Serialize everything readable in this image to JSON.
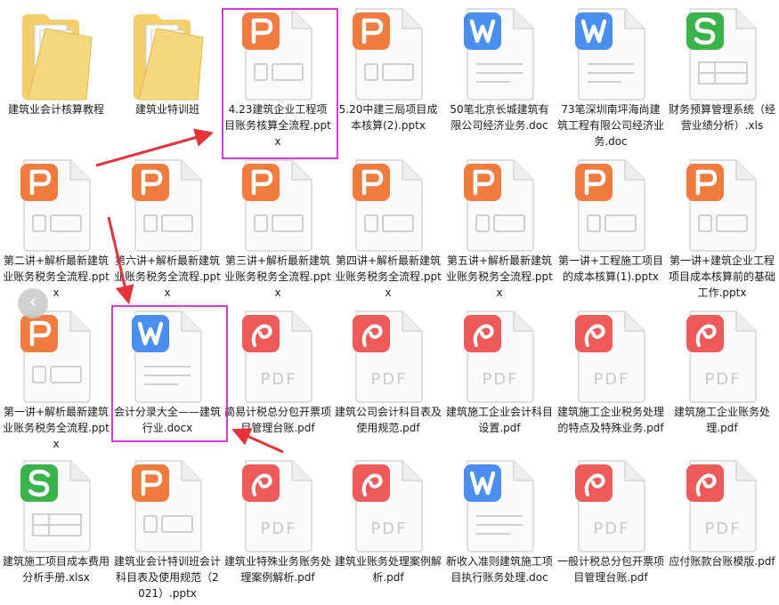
{
  "files": [
    {
      "name": "建筑业会计核算教程",
      "type": "folder",
      "icon": "folder-icon"
    },
    {
      "name": "建筑业特训班",
      "type": "folder",
      "icon": "folder-icon"
    },
    {
      "name": "4.23建筑企业工程项目账务核算全流程.pptx",
      "type": "pptx",
      "icon": "pptx-file-icon"
    },
    {
      "name": "5.20中建三局项目成本核算(2).pptx",
      "type": "pptx",
      "icon": "pptx-file-icon"
    },
    {
      "name": "50笔北京长城建筑有限公司经济业务.doc",
      "type": "doc",
      "icon": "doc-file-icon"
    },
    {
      "name": "73笔深圳南坪海尚建筑工程有限公司经济业务.doc",
      "type": "doc",
      "icon": "doc-file-icon"
    },
    {
      "name": "财务预算管理系统（经营业绩分析）.xls",
      "type": "xls",
      "icon": "xls-file-icon"
    },
    {
      "name": "第二讲+解析最新建筑业账务税务全流程.pptx",
      "type": "pptx",
      "icon": "pptx-file-icon"
    },
    {
      "name": "第六讲+解析最新建筑业账务税务全流程.pptx",
      "type": "pptx",
      "icon": "pptx-file-icon"
    },
    {
      "name": "第三讲+解析最新建筑业账务税务全流程.pptx",
      "type": "pptx",
      "icon": "pptx-file-icon"
    },
    {
      "name": "第四讲+解析最新建筑业账务税务全流程.pptx",
      "type": "pptx",
      "icon": "pptx-file-icon"
    },
    {
      "name": "第五讲+解析最新建筑业账务税务全流程.pptx",
      "type": "pptx",
      "icon": "pptx-file-icon"
    },
    {
      "name": "第一讲+工程施工项目的成本核算(1).pptx",
      "type": "pptx",
      "icon": "pptx-file-icon"
    },
    {
      "name": "第一讲+建筑企业工程项目成本核算前的基础工作.pptx",
      "type": "pptx",
      "icon": "pptx-file-icon"
    },
    {
      "name": "第一讲+解析最新建筑业账务税务全流程.pptx",
      "type": "pptx",
      "icon": "pptx-file-icon"
    },
    {
      "name": "会计分录大全——建筑行业.docx",
      "type": "doc",
      "icon": "doc-file-icon"
    },
    {
      "name": "简易计税总分包开票项目管理台账.pdf",
      "type": "pdf",
      "icon": "pdf-file-icon"
    },
    {
      "name": "建筑公司会计科目表及使用规范.pdf",
      "type": "pdf",
      "icon": "pdf-file-icon"
    },
    {
      "name": "建筑施工企业会计科目设置.pdf",
      "type": "pdf",
      "icon": "pdf-file-icon"
    },
    {
      "name": "建筑施工企业税务处理的特点及特殊业务.pdf",
      "type": "pdf",
      "icon": "pdf-file-icon"
    },
    {
      "name": "建筑施工企业账务处理.pdf",
      "type": "pdf",
      "icon": "pdf-file-icon"
    },
    {
      "name": "建筑施工项目成本费用分析手册.xlsx",
      "type": "xls",
      "icon": "xls-file-icon"
    },
    {
      "name": "建筑业会计特训班会计科目表及使用规范（2021）.pptx",
      "type": "pptx",
      "icon": "pptx-file-icon"
    },
    {
      "name": "建筑业特殊业务账务处理案例解析.pdf",
      "type": "pdf",
      "icon": "pdf-file-icon"
    },
    {
      "name": "建筑业账务处理案例解析.pdf",
      "type": "pdf",
      "icon": "pdf-file-icon"
    },
    {
      "name": "新收入准则建筑施工项目执行账务处理.doc",
      "type": "doc",
      "icon": "doc-file-icon"
    },
    {
      "name": "一般计税总分包开票项目管理台账.pdf",
      "type": "pdf",
      "icon": "pdf-file-icon"
    },
    {
      "name": "应付账款台账模版.pdf",
      "type": "pdf",
      "icon": "pdf-file-icon"
    }
  ],
  "icon_text": {
    "pdf_word": "PDF"
  },
  "scroll_button": {
    "icon": "chevron-left-icon",
    "glyph": "‹"
  },
  "colors": {
    "pptx": "#f07b3f",
    "doc": "#4a8ff0",
    "xls": "#3ab44a",
    "pdf": "#ee5a5a",
    "highlight": "#d63ad6",
    "arrow": "#e8313a",
    "folder": "#f2cf6b"
  }
}
